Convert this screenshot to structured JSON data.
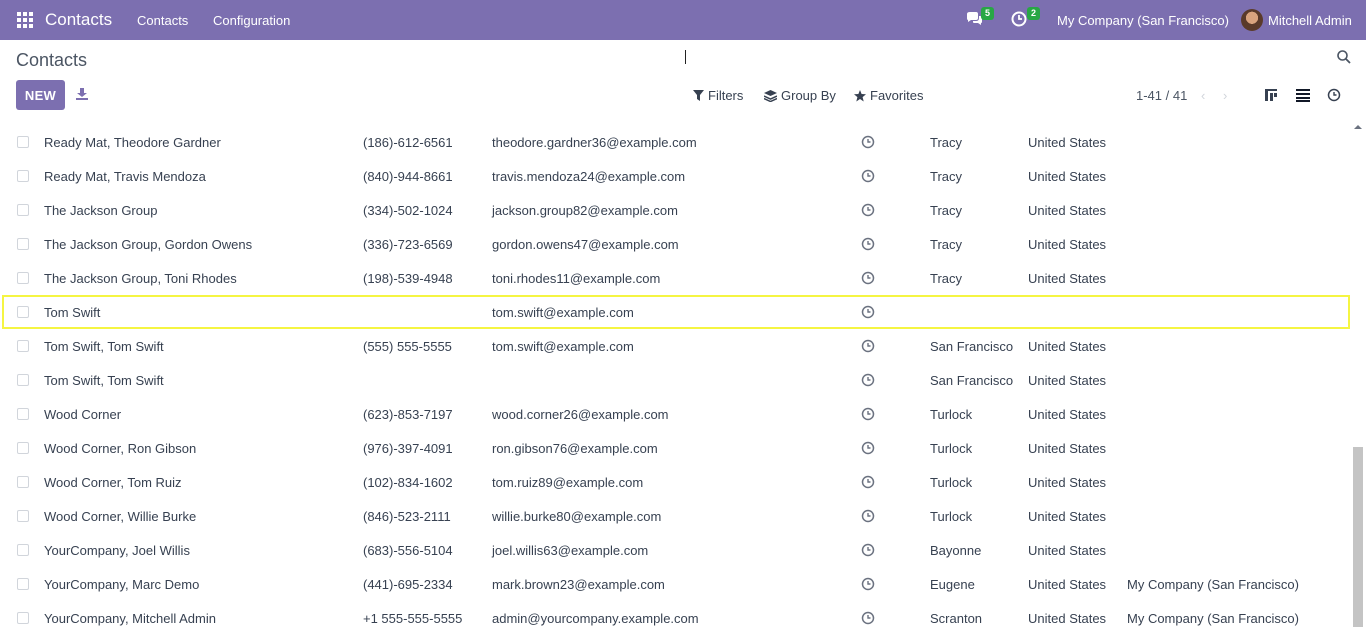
{
  "navbar": {
    "app_name": "Contacts",
    "menu": [
      "Contacts",
      "Configuration"
    ],
    "chat_badge": "5",
    "activity_badge": "2",
    "company": "My Company (San Francisco)",
    "user": "Mitchell Admin"
  },
  "control_panel": {
    "breadcrumb": "Contacts",
    "new_label": "NEW",
    "filters_label": "Filters",
    "groupby_label": "Group By",
    "favorites_label": "Favorites",
    "pager": "1-41 / 41",
    "pager_prev": "‹",
    "pager_next": "›"
  },
  "rows": [
    {
      "name": "Ready Mat, Theodore Gardner",
      "phone": "(186)-612-6561",
      "email": "theodore.gardner36@example.com",
      "city": "Tracy",
      "country": "United States",
      "company": ""
    },
    {
      "name": "Ready Mat, Travis Mendoza",
      "phone": "(840)-944-8661",
      "email": "travis.mendoza24@example.com",
      "city": "Tracy",
      "country": "United States",
      "company": ""
    },
    {
      "name": "The Jackson Group",
      "phone": "(334)-502-1024",
      "email": "jackson.group82@example.com",
      "city": "Tracy",
      "country": "United States",
      "company": ""
    },
    {
      "name": "The Jackson Group, Gordon Owens",
      "phone": "(336)-723-6569",
      "email": "gordon.owens47@example.com",
      "city": "Tracy",
      "country": "United States",
      "company": ""
    },
    {
      "name": "The Jackson Group, Toni Rhodes",
      "phone": "(198)-539-4948",
      "email": "toni.rhodes11@example.com",
      "city": "Tracy",
      "country": "United States",
      "company": ""
    },
    {
      "name": "Tom Swift",
      "phone": "",
      "email": "tom.swift@example.com",
      "city": "",
      "country": "",
      "company": ""
    },
    {
      "name": "Tom Swift, Tom Swift",
      "phone": "(555) 555-5555",
      "email": "tom.swift@example.com",
      "city": "San Francisco",
      "country": "United States",
      "company": ""
    },
    {
      "name": "Tom Swift, Tom Swift",
      "phone": "",
      "email": "",
      "city": "San Francisco",
      "country": "United States",
      "company": ""
    },
    {
      "name": "Wood Corner",
      "phone": "(623)-853-7197",
      "email": "wood.corner26@example.com",
      "city": "Turlock",
      "country": "United States",
      "company": ""
    },
    {
      "name": "Wood Corner, Ron Gibson",
      "phone": "(976)-397-4091",
      "email": "ron.gibson76@example.com",
      "city": "Turlock",
      "country": "United States",
      "company": ""
    },
    {
      "name": "Wood Corner, Tom Ruiz",
      "phone": "(102)-834-1602",
      "email": "tom.ruiz89@example.com",
      "city": "Turlock",
      "country": "United States",
      "company": ""
    },
    {
      "name": "Wood Corner, Willie Burke",
      "phone": "(846)-523-2111",
      "email": "willie.burke80@example.com",
      "city": "Turlock",
      "country": "United States",
      "company": ""
    },
    {
      "name": "YourCompany, Joel Willis",
      "phone": "(683)-556-5104",
      "email": "joel.willis63@example.com",
      "city": "Bayonne",
      "country": "United States",
      "company": ""
    },
    {
      "name": "YourCompany, Marc Demo",
      "phone": "(441)-695-2334",
      "email": "mark.brown23@example.com",
      "city": "Eugene",
      "country": "United States",
      "company": "My Company (San Francisco)"
    },
    {
      "name": "YourCompany, Mitchell Admin",
      "phone": "+1 555-555-5555",
      "email": "admin@yourcompany.example.com",
      "city": "Scranton",
      "country": "United States",
      "company": "My Company (San Francisco)"
    }
  ]
}
